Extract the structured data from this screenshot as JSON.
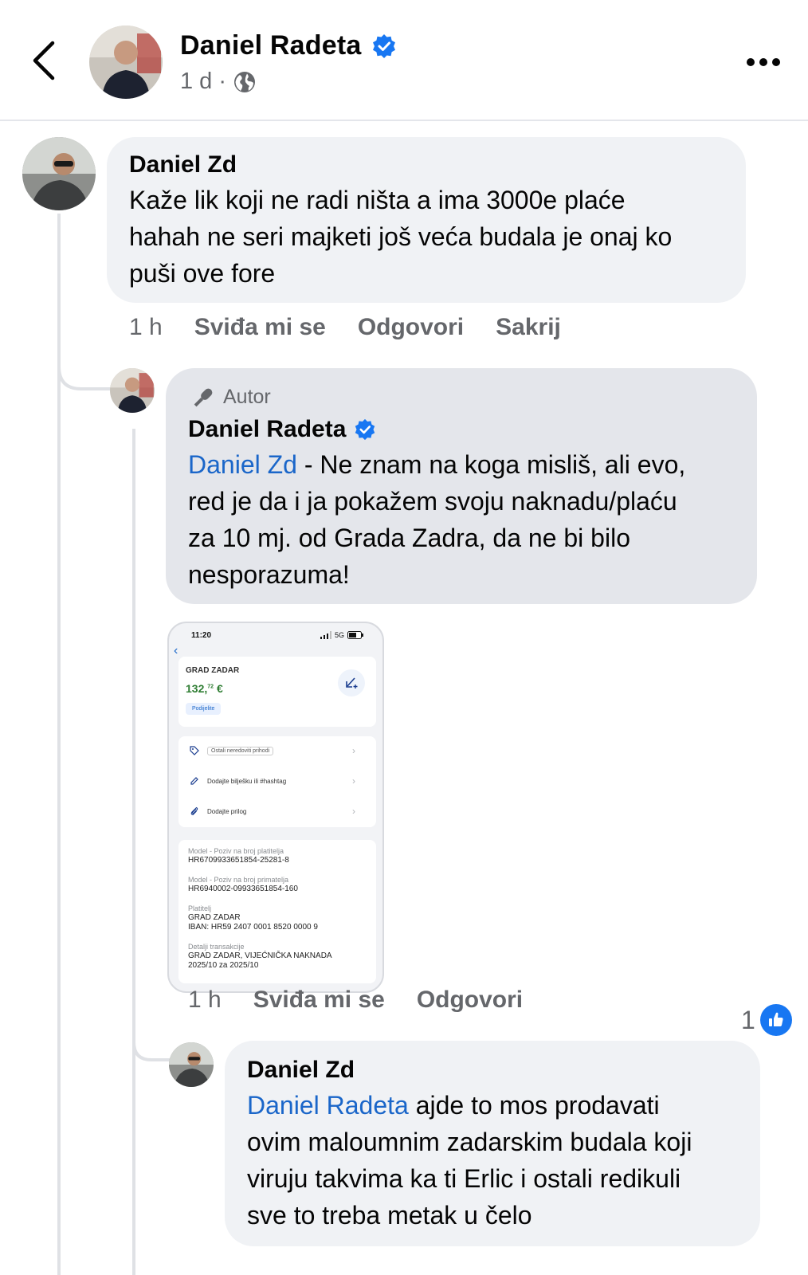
{
  "header": {
    "name": "Daniel Radeta",
    "time": "1 d",
    "separator": "·",
    "icons": [
      "back-chevron-icon",
      "verified-icon",
      "globe-icon",
      "more-icon"
    ]
  },
  "comment1": {
    "author": "Daniel Zd",
    "text_lines": [
      "Kaže lik koji ne radi ništa a ima 3000e plaće",
      "hahah ne seri majketi još veća budala je onaj ko",
      "puši ove fore"
    ],
    "time": "1 h",
    "like": "Sviđa mi se",
    "reply": "Odgovori",
    "hide": "Sakrij"
  },
  "reply1": {
    "tag": "Autor",
    "author": "Daniel Radeta",
    "mention": "Daniel Zd",
    "first_line_rest": " - Ne znam na koga misliš, ali evo,",
    "text_lines": [
      "red je da i ja pokažem svoju naknadu/plaću",
      "za 10 mj. od Grada Zadra, da ne bi bilo",
      "nesporazuma!"
    ],
    "time": "1 h",
    "like": "Sviđa mi se",
    "reply": "Odgovori",
    "like_count": "1",
    "attachment": {
      "status_time": "11:20",
      "network": "5G",
      "payer_title": "GRAD ZADAR",
      "amount_main": "132,",
      "amount_cents": "72",
      "currency": "€",
      "share_button": "Podijelite",
      "category": "Ostali neredoviti prihodi",
      "note_placeholder": "Dodajte bilješku ili #hashtag",
      "attach_label": "Dodajte prilog",
      "payer_ref_label": "Model - Poziv na broj platitelja",
      "payer_ref": "HR6709933651854-25281-8",
      "recipient_ref_label": "Model - Poziv na broj primatelja",
      "recipient_ref": "HR6940002-09933651854-160",
      "payer_label": "Platitelj",
      "payer_name": "GRAD ZADAR",
      "iban": "IBAN: HR59 2407 0001 8520 0000 9",
      "details_label": "Detalji transakcije",
      "details_line1": "GRAD ZADAR, VIJEĆNIČKA NAKNADA",
      "details_line2": "2025/10 za 2025/10"
    }
  },
  "reply2": {
    "author": "Daniel Zd",
    "mention": "Daniel Radeta",
    "first_line_rest": " ajde to mos prodavati",
    "text_lines": [
      "ovim maloumnim zadarskim budala koji",
      "viruju takvima ka ti Erlic i ostali redikuli",
      "sve to treba metak u čelo"
    ]
  },
  "colors": {
    "bubble": "#f0f2f5",
    "author_bubble": "#e4e6eb",
    "mention": "#1a66c9",
    "verified": "#1877f2",
    "secondary_text": "#65676b"
  }
}
